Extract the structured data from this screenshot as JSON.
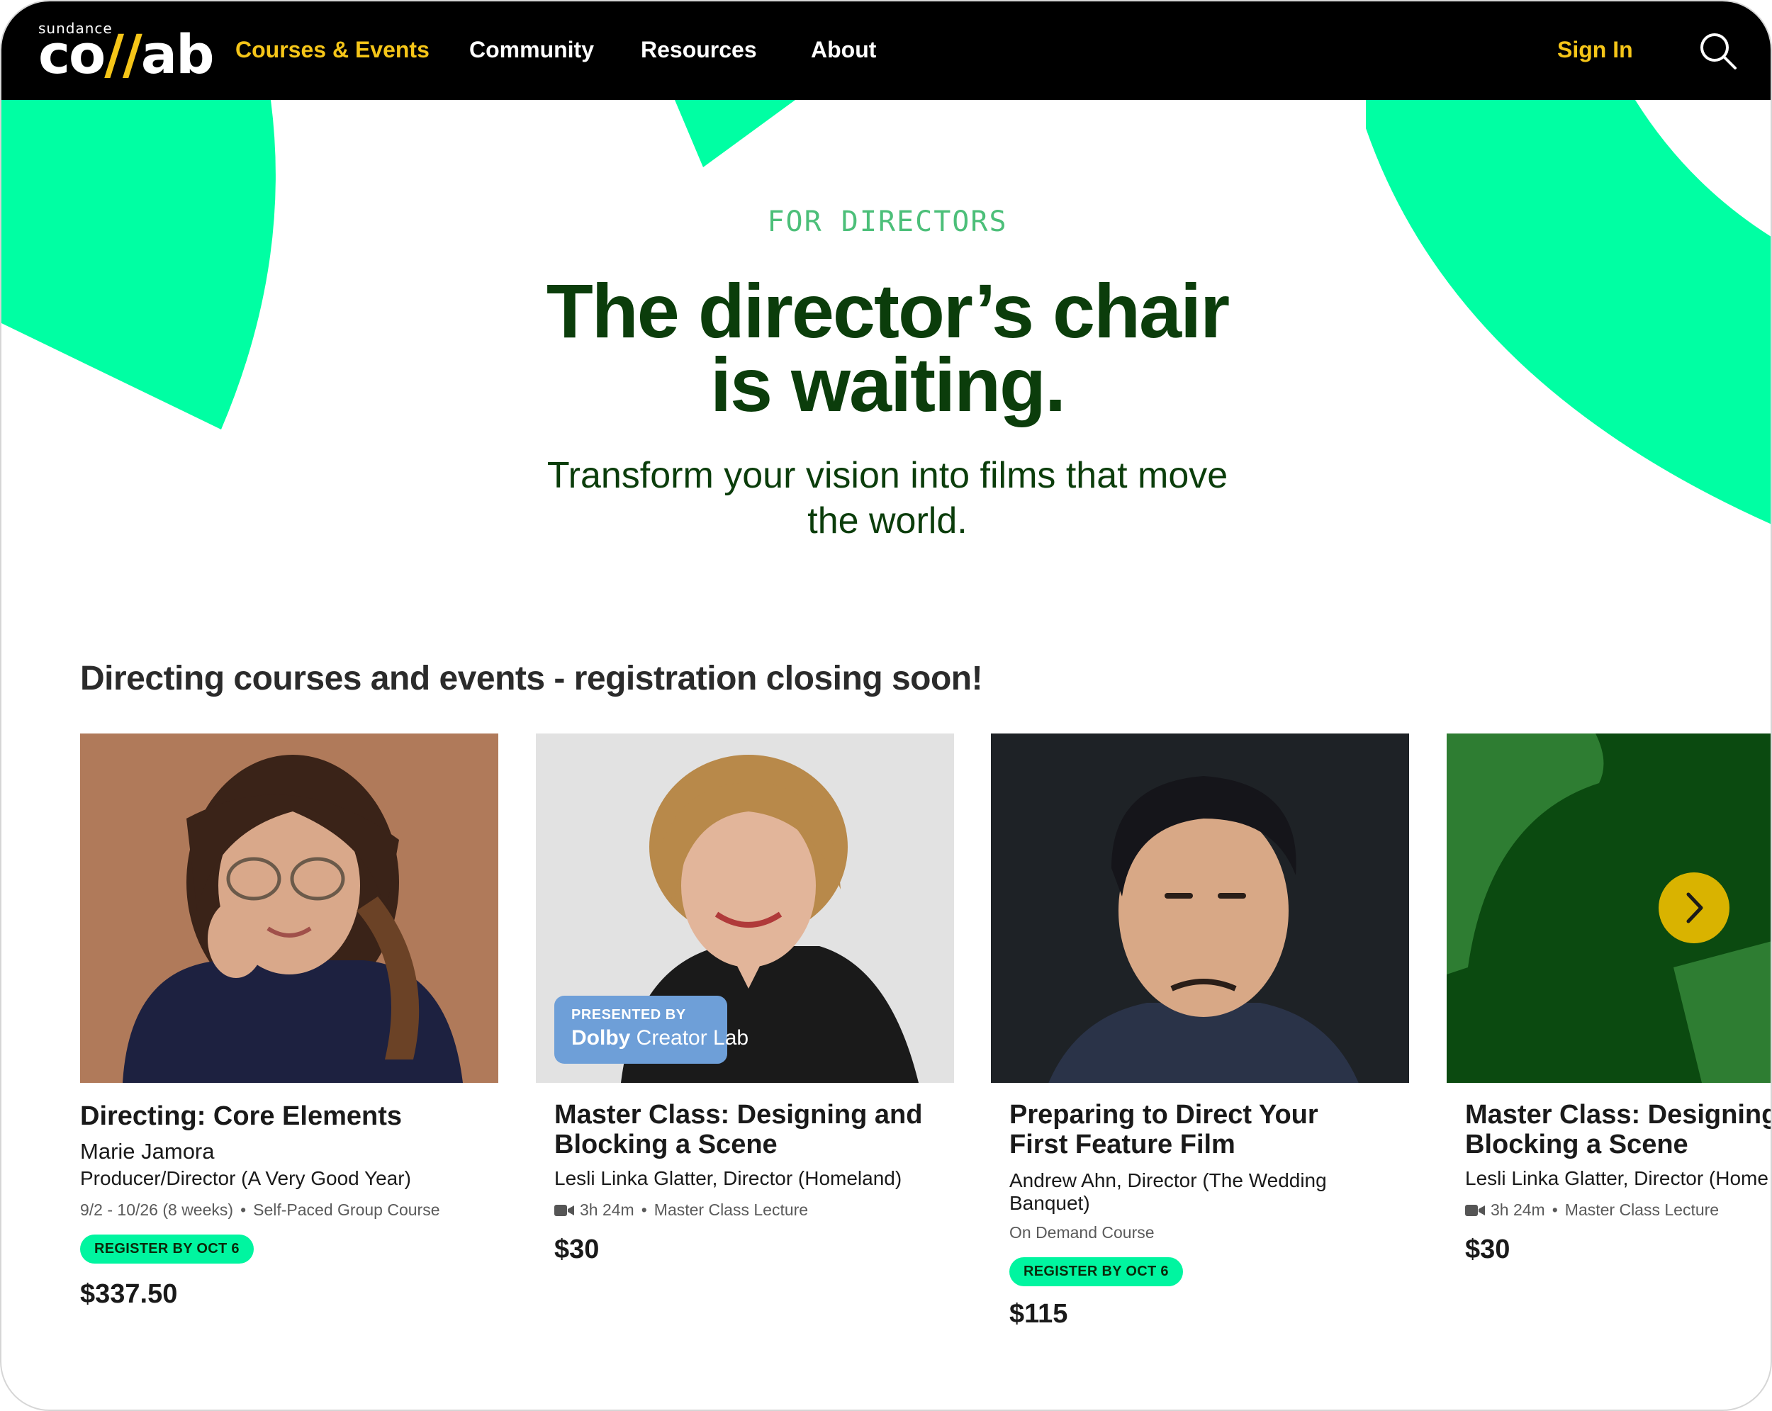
{
  "nav": {
    "logo_small": "sundance",
    "logo_co": "co",
    "logo_bars": "//",
    "logo_ab": "ab",
    "links": [
      "Courses & Events",
      "Community",
      "Resources",
      "About"
    ],
    "sign_in": "Sign In",
    "search_icon": "search-icon"
  },
  "colors": {
    "accent_green": "#00FFA3",
    "brand_yellow": "#F5C518",
    "dark_green": "#0B3D0B",
    "eyebrow_green": "#4CBF79"
  },
  "hero": {
    "eyebrow": "FOR DIRECTORS",
    "title_line1": "The director’s chair",
    "title_line2": "is waiting.",
    "subtitle_line1": "Transform your vision into films that move",
    "subtitle_line2": "the world."
  },
  "section": {
    "heading": "Directing courses and events - registration closing soon!"
  },
  "cards": [
    {
      "title": "Directing: Core Elements",
      "instructor": "Marie Jamora",
      "role": "Producer/Director (A Very Good Year)",
      "dates": "9/2 - 10/26 (8 weeks)",
      "type": "Self-Paced Group Course",
      "badge": "REGISTER BY OCT 6",
      "price": "$337.50"
    },
    {
      "title_line1": "Master Class: Designing and",
      "title_line2": "Blocking a Scene",
      "instructor": "Lesli Linka Glatter, Director (Homeland)",
      "duration": "3h 24m",
      "type": "Master Class Lecture",
      "price": "$30",
      "presented_by": "PRESENTED BY",
      "sponsor_bold": "Dolby",
      "sponsor_light": " Creator Lab",
      "video_icon": "video-camera-icon"
    },
    {
      "title_line1": "Preparing to Direct Your",
      "title_line2": "First Feature Film",
      "instructor_line1": "Andrew Ahn, Director (The Wedding",
      "instructor_line2": "Banquet)",
      "type": "On Demand Course",
      "badge": "REGISTER BY OCT 6",
      "price": "$115"
    },
    {
      "title_line1": "Master Class: Designing",
      "title_line2": "Blocking a Scene",
      "instructor": "Lesli Linka Glatter, Director (Home",
      "duration": "3h 24m",
      "type": "Master Class Lecture",
      "price": "$30",
      "video_icon": "video-camera-icon"
    }
  ],
  "carousel": {
    "next_icon": "chevron-right-icon"
  }
}
